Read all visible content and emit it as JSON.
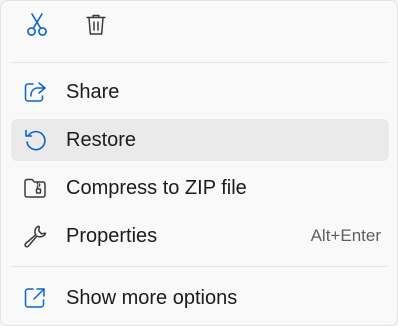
{
  "toolbar": {
    "cut_icon": "scissors-icon",
    "delete_icon": "trash-icon",
    "accent": "#0a64c8"
  },
  "menu": {
    "items": [
      {
        "label": "Share",
        "icon": "share-icon",
        "shortcut": ""
      },
      {
        "label": "Restore",
        "icon": "restore-icon",
        "shortcut": "",
        "highlighted": true
      },
      {
        "label": "Compress to ZIP file",
        "icon": "zip-folder-icon",
        "shortcut": ""
      },
      {
        "label": "Properties",
        "icon": "wrench-icon",
        "shortcut": "Alt+Enter"
      }
    ],
    "more": {
      "label": "Show more options",
      "icon": "open-external-icon"
    }
  }
}
